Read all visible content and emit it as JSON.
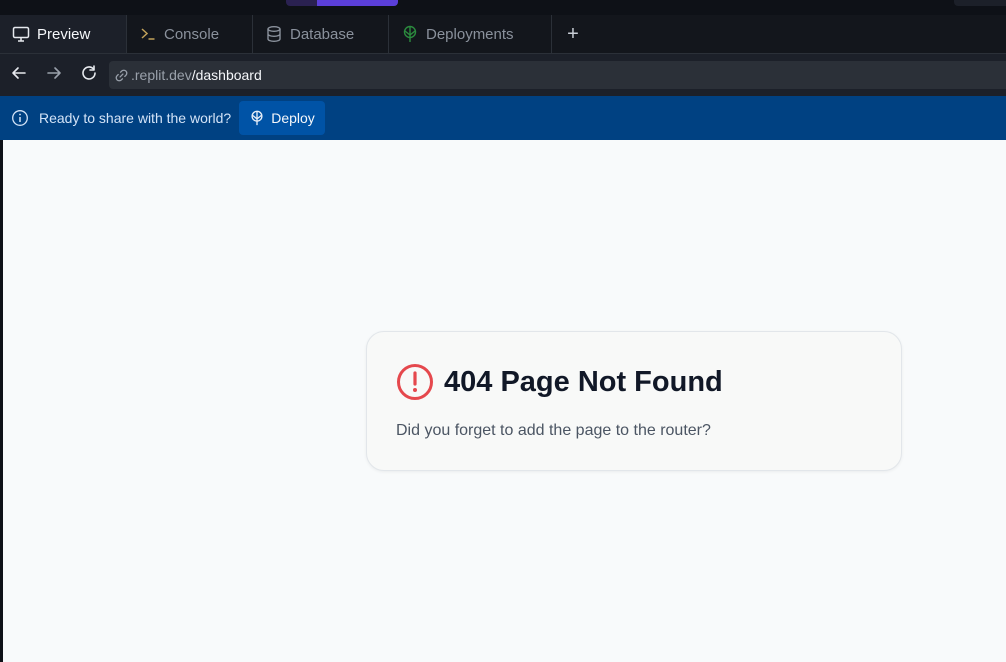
{
  "tabs": [
    {
      "label": "Preview",
      "icon": "monitor-icon",
      "active": true
    },
    {
      "label": "Console",
      "icon": "terminal-icon",
      "active": false
    },
    {
      "label": "Database",
      "icon": "database-icon",
      "active": false
    },
    {
      "label": "Deployments",
      "icon": "deployments-icon",
      "active": false
    }
  ],
  "tabbar": {
    "add_label": "+"
  },
  "address": {
    "domain": ".replit.dev",
    "path": "/dashboard"
  },
  "banner": {
    "message": "Ready to share with the world?",
    "button_label": "Deploy"
  },
  "error_card": {
    "title": "404 Page Not Found",
    "description": "Did you forget to add the page to the router?"
  },
  "colors": {
    "accent": "#5b3fd9",
    "banner_bg": "#004182",
    "error_red": "#e5484d",
    "deployments_icon": "#2b8a3e"
  }
}
